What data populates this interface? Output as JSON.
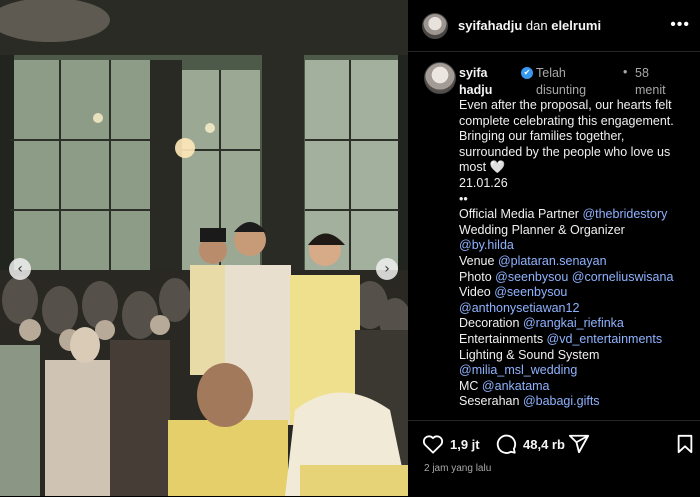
{
  "header": {
    "user": "syifahadju",
    "connector": " dan ",
    "collaborator": "elelrumi"
  },
  "caption": {
    "username": "syifahadju",
    "edited": "Telah disunting",
    "separator": "•",
    "time": "58 menit",
    "lines": [
      "Even after the proposal, our hearts felt",
      "complete celebrating this engagement.",
      "Bringing our families together,",
      "surrounded by the people who love us",
      "most 🤍",
      "21.01.26",
      "••"
    ],
    "credits": [
      {
        "label": "Official Media Partner ",
        "handle": "@thebridestory"
      },
      {
        "label": "Wedding Planner & Organizer",
        "handle": ""
      },
      {
        "label": "",
        "handle": "@by.hilda"
      },
      {
        "label": "Venue ",
        "handle": "@plataran.senayan"
      },
      {
        "label": "Photo ",
        "handle": "@seenbysou",
        "extra": "@corneliuswisana"
      },
      {
        "label": "Video ",
        "handle": "@seenbysou"
      },
      {
        "label": "",
        "handle": "@anthonysetiawan12"
      },
      {
        "label": "Decoration ",
        "handle": "@rangkai_riefinka"
      },
      {
        "label": "Entertainments ",
        "handle": "@vd_entertainments"
      },
      {
        "label": "Lighting & Sound System",
        "handle": ""
      },
      {
        "label": "",
        "handle": "@milia_msl_wedding"
      },
      {
        "label": "MC ",
        "handle": "@ankatama"
      },
      {
        "label": "Seserahan ",
        "handle": "@babagi.gifts"
      }
    ]
  },
  "actions": {
    "likes": "1,9 jt",
    "comments": "48,4 rb",
    "posted": "2 jam yang lalu"
  },
  "icons": {
    "like": "heart-icon",
    "comment": "comment-icon",
    "share": "share-icon",
    "save": "bookmark-icon",
    "more": "more-icon",
    "prev": "chevron-left-icon",
    "next": "chevron-right-icon",
    "verified": "verified-badge-icon"
  },
  "colors": {
    "link": "#8fb3ff",
    "verified": "#3897f0",
    "muted": "#a8a8a8"
  }
}
